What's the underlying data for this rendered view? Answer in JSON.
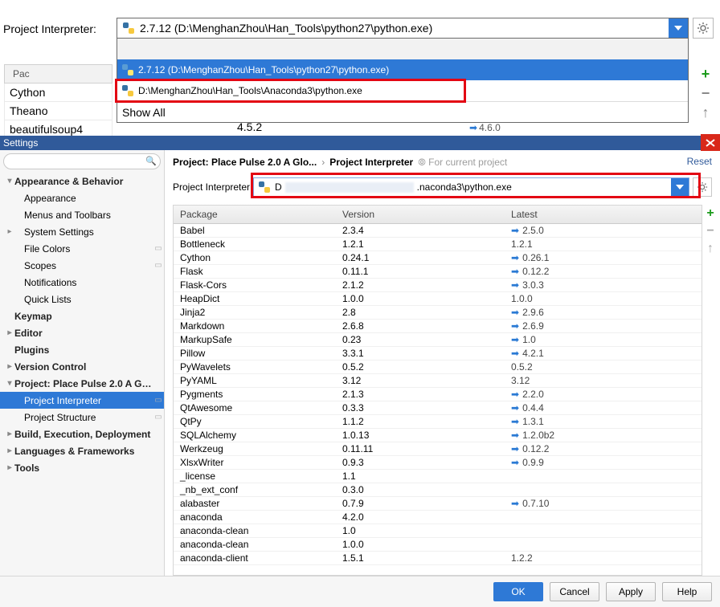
{
  "top": {
    "label": "Project Interpreter:",
    "selected": "2.7.12 (D:\\MenghanZhou\\Han_Tools\\python27\\python.exe)",
    "options": [
      "2.7.12 (D:\\MenghanZhou\\Han_Tools\\python27\\python.exe)",
      "D:\\MenghanZhou\\Han_Tools\\Anaconda3\\python.exe"
    ],
    "showAll": "Show All"
  },
  "bg": {
    "hdr": "Pac",
    "rows": [
      "Cython",
      "Theano",
      "beautifulsoup4"
    ],
    "ver": "4.5.2",
    "lat": "4.6.0"
  },
  "settingsTab": "Settings",
  "sidebar": {
    "searchPlaceholder": "",
    "items": [
      {
        "label": "Appearance & Behavior",
        "lvl": 0,
        "caret": "▾",
        "bold": true
      },
      {
        "label": "Appearance",
        "lvl": 1
      },
      {
        "label": "Menus and Toolbars",
        "lvl": 1
      },
      {
        "label": "System Settings",
        "lvl": 1,
        "caret": "▸"
      },
      {
        "label": "File Colors",
        "lvl": 1,
        "badge": "▭"
      },
      {
        "label": "Scopes",
        "lvl": 1,
        "badge": "▭"
      },
      {
        "label": "Notifications",
        "lvl": 1
      },
      {
        "label": "Quick Lists",
        "lvl": 1
      },
      {
        "label": "Keymap",
        "lvl": 0,
        "bold": true
      },
      {
        "label": "Editor",
        "lvl": 0,
        "caret": "▸",
        "bold": true
      },
      {
        "label": "Plugins",
        "lvl": 0,
        "bold": true
      },
      {
        "label": "Version Control",
        "lvl": 0,
        "caret": "▸",
        "bold": true
      },
      {
        "label": "Project: Place Pulse 2.0 A Glo...",
        "lvl": 0,
        "caret": "▾",
        "bold": true
      },
      {
        "label": "Project Interpreter",
        "lvl": 1,
        "badge": "▭",
        "selected": true
      },
      {
        "label": "Project Structure",
        "lvl": 1,
        "badge": "▭"
      },
      {
        "label": "Build, Execution, Deployment",
        "lvl": 0,
        "caret": "▸",
        "bold": true
      },
      {
        "label": "Languages & Frameworks",
        "lvl": 0,
        "caret": "▸",
        "bold": true
      },
      {
        "label": "Tools",
        "lvl": 0,
        "caret": "▸",
        "bold": true
      }
    ]
  },
  "crumbs": {
    "path1": "Project: Place Pulse 2.0 A Glo...",
    "path2": "Project Interpreter",
    "hint": "⦾ For current project",
    "reset": "Reset"
  },
  "interp2": {
    "label": "Project Interpreter:",
    "prefix": "D",
    "suffix": ".naconda3\\python.exe"
  },
  "pkgHdr": {
    "pkg": "Package",
    "ver": "Version",
    "lat": "Latest"
  },
  "packages": [
    {
      "p": "Babel",
      "v": "2.3.4",
      "l": "2.5.0",
      "a": true
    },
    {
      "p": "Bottleneck",
      "v": "1.2.1",
      "l": "1.2.1"
    },
    {
      "p": "Cython",
      "v": "0.24.1",
      "l": "0.26.1",
      "a": true
    },
    {
      "p": "Flask",
      "v": "0.11.1",
      "l": "0.12.2",
      "a": true
    },
    {
      "p": "Flask-Cors",
      "v": "2.1.2",
      "l": "3.0.3",
      "a": true
    },
    {
      "p": "HeapDict",
      "v": "1.0.0",
      "l": "1.0.0"
    },
    {
      "p": "Jinja2",
      "v": "2.8",
      "l": "2.9.6",
      "a": true
    },
    {
      "p": "Markdown",
      "v": "2.6.8",
      "l": "2.6.9",
      "a": true
    },
    {
      "p": "MarkupSafe",
      "v": "0.23",
      "l": "1.0",
      "a": true
    },
    {
      "p": "Pillow",
      "v": "3.3.1",
      "l": "4.2.1",
      "a": true
    },
    {
      "p": "PyWavelets",
      "v": "0.5.2",
      "l": "0.5.2"
    },
    {
      "p": "PyYAML",
      "v": "3.12",
      "l": "3.12"
    },
    {
      "p": "Pygments",
      "v": "2.1.3",
      "l": "2.2.0",
      "a": true
    },
    {
      "p": "QtAwesome",
      "v": "0.3.3",
      "l": "0.4.4",
      "a": true
    },
    {
      "p": "QtPy",
      "v": "1.1.2",
      "l": "1.3.1",
      "a": true
    },
    {
      "p": "SQLAlchemy",
      "v": "1.0.13",
      "l": "1.2.0b2",
      "a": true
    },
    {
      "p": "Werkzeug",
      "v": "0.11.11",
      "l": "0.12.2",
      "a": true
    },
    {
      "p": "XlsxWriter",
      "v": "0.9.3",
      "l": "0.9.9",
      "a": true
    },
    {
      "p": "_license",
      "v": "1.1",
      "l": ""
    },
    {
      "p": "_nb_ext_conf",
      "v": "0.3.0",
      "l": ""
    },
    {
      "p": "alabaster",
      "v": "0.7.9",
      "l": "0.7.10",
      "a": true
    },
    {
      "p": "anaconda",
      "v": "4.2.0",
      "l": ""
    },
    {
      "p": "anaconda-clean",
      "v": "1.0",
      "l": ""
    },
    {
      "p": "anaconda-clean",
      "v": "1.0.0",
      "l": ""
    },
    {
      "p": "anaconda-client",
      "v": "1.5.1",
      "l": "1.2.2"
    }
  ],
  "buttons": {
    "ok": "OK",
    "cancel": "Cancel",
    "apply": "Apply",
    "help": "Help"
  }
}
